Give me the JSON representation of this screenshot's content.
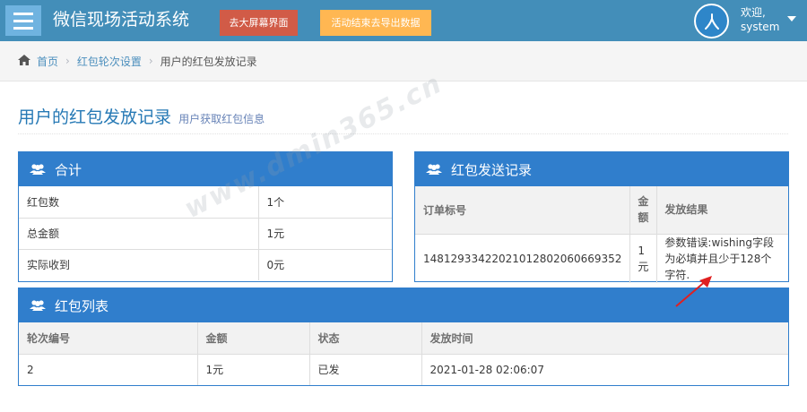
{
  "navbar": {
    "brand": "微信现场活动系统",
    "big_screen_button": "去大屏幕界面",
    "export_button": "活动结束去导出数据",
    "user_greeting": "欢迎,",
    "user_name": "system",
    "colors": {
      "navbar": "#438eb9",
      "red_button": "#d15b47",
      "orange_button": "#ffb752"
    }
  },
  "breadcrumb": {
    "home": "首页",
    "rounds": "红包轮次设置",
    "current": "用户的红包发放记录"
  },
  "page_header": {
    "title": "用户的红包发放记录",
    "subtitle": "用户获取红包信息"
  },
  "summary_box": {
    "title": "合计",
    "rows": [
      {
        "label": "红包数",
        "value": "1个"
      },
      {
        "label": "总金额",
        "value": "1元"
      },
      {
        "label": "实际收到",
        "value": "0元"
      }
    ]
  },
  "send_box": {
    "title": "红包发送记录",
    "headers": {
      "order_no": "订单标号",
      "amount": "金额",
      "result": "发放结果"
    },
    "rows": [
      {
        "order_no": "14812933422021012802060669352",
        "amount": "1元",
        "result": "参数错误:wishing字段为必填并且少于128个字符."
      }
    ]
  },
  "list_box": {
    "title": "红包列表",
    "headers": {
      "round_no": "轮次编号",
      "amount": "金额",
      "status": "状态",
      "time": "发放时间"
    },
    "rows": [
      {
        "round_no": "2",
        "amount": "1元",
        "status": "已发",
        "time": "2021-01-28 02:06:07"
      }
    ]
  },
  "watermark_text": "www.dmin365.cn",
  "box_color": "#307ecc"
}
